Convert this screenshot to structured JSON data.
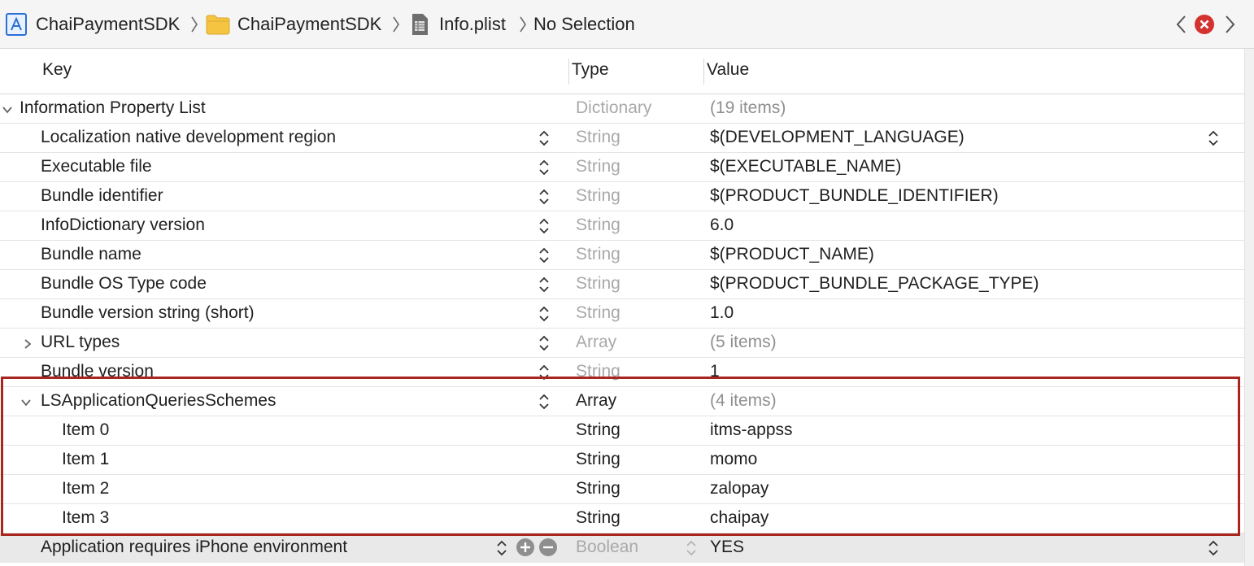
{
  "breadcrumb": {
    "project": "ChaiPaymentSDK",
    "folder": "ChaiPaymentSDK",
    "file": "Info.plist",
    "selection": "No Selection"
  },
  "icons": {
    "project": "xcode-project-icon",
    "folder": "folder-icon",
    "file": "plist-file-icon",
    "back": "chevron-left-icon",
    "forward": "chevron-right-icon",
    "close": "close-icon"
  },
  "colors": {
    "highlight": "#a8261d",
    "close": "#d3322f",
    "folder": "#f5c542"
  },
  "columns": {
    "key": "Key",
    "type": "Type",
    "value": "Value"
  },
  "rows": [
    {
      "key": "Information Property List",
      "type": "Dictionary",
      "value": "(19 items)"
    },
    {
      "key": "Localization native development region",
      "type": "String",
      "value": "$(DEVELOPMENT_LANGUAGE)"
    },
    {
      "key": "Executable file",
      "type": "String",
      "value": "$(EXECUTABLE_NAME)"
    },
    {
      "key": "Bundle identifier",
      "type": "String",
      "value": "$(PRODUCT_BUNDLE_IDENTIFIER)"
    },
    {
      "key": "InfoDictionary version",
      "type": "String",
      "value": "6.0"
    },
    {
      "key": "Bundle name",
      "type": "String",
      "value": "$(PRODUCT_NAME)"
    },
    {
      "key": "Bundle OS Type code",
      "type": "String",
      "value": "$(PRODUCT_BUNDLE_PACKAGE_TYPE)"
    },
    {
      "key": "Bundle version string (short)",
      "type": "String",
      "value": "1.0"
    },
    {
      "key": "URL types",
      "type": "Array",
      "value": "(5 items)"
    },
    {
      "key": "Bundle version",
      "type": "String",
      "value": "1"
    },
    {
      "key": "LSApplicationQueriesSchemes",
      "type": "Array",
      "value": "(4 items)"
    },
    {
      "key": "Item 0",
      "type": "String",
      "value": "itms-appss"
    },
    {
      "key": "Item 1",
      "type": "String",
      "value": "momo"
    },
    {
      "key": "Item 2",
      "type": "String",
      "value": "zalopay"
    },
    {
      "key": "Item 3",
      "type": "String",
      "value": "chaipay"
    },
    {
      "key": "Application requires iPhone environment",
      "type": "Boolean",
      "value": "YES"
    }
  ]
}
